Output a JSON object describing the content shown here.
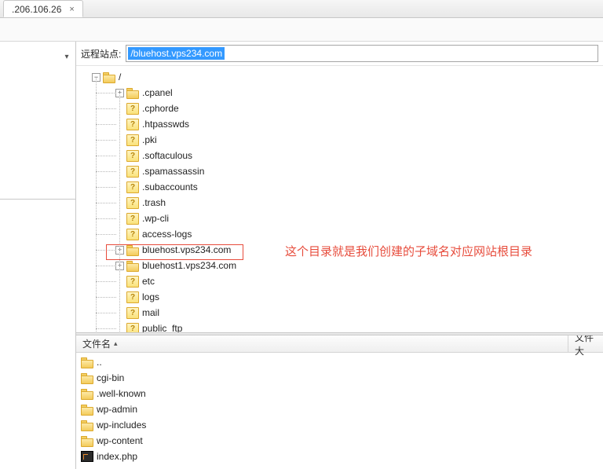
{
  "tab": {
    "label": ".206.106.26",
    "close": "×"
  },
  "remote": {
    "label": "远程站点:",
    "path": "/bluehost.vps234.com"
  },
  "tree": {
    "root": "/",
    "items": [
      {
        "name": ".cpanel",
        "type": "folder",
        "expandable": true
      },
      {
        "name": ".cphorde",
        "type": "unknown",
        "expandable": false
      },
      {
        "name": ".htpasswds",
        "type": "unknown",
        "expandable": false
      },
      {
        "name": ".pki",
        "type": "unknown",
        "expandable": false
      },
      {
        "name": ".softaculous",
        "type": "unknown",
        "expandable": false
      },
      {
        "name": ".spamassassin",
        "type": "unknown",
        "expandable": false
      },
      {
        "name": ".subaccounts",
        "type": "unknown",
        "expandable": false
      },
      {
        "name": ".trash",
        "type": "unknown",
        "expandable": false
      },
      {
        "name": ".wp-cli",
        "type": "unknown",
        "expandable": false
      },
      {
        "name": "access-logs",
        "type": "unknown",
        "expandable": false
      },
      {
        "name": "bluehost.vps234.com",
        "type": "folder",
        "expandable": true,
        "highlighted": true
      },
      {
        "name": "bluehost1.vps234.com",
        "type": "folder",
        "expandable": true
      },
      {
        "name": "etc",
        "type": "unknown",
        "expandable": false
      },
      {
        "name": "logs",
        "type": "unknown",
        "expandable": false
      },
      {
        "name": "mail",
        "type": "unknown",
        "expandable": false
      },
      {
        "name": "public_ftp",
        "type": "unknown",
        "expandable": false
      }
    ]
  },
  "annotation_text": "这个目录就是我们创建的子域名对应网站根目录",
  "file_list": {
    "columns": {
      "name": "文件名",
      "size": "文件大"
    },
    "rows": [
      {
        "name": "..",
        "type": "folder"
      },
      {
        "name": "cgi-bin",
        "type": "folder"
      },
      {
        "name": ".well-known",
        "type": "folder"
      },
      {
        "name": "wp-admin",
        "type": "folder"
      },
      {
        "name": "wp-includes",
        "type": "folder"
      },
      {
        "name": "wp-content",
        "type": "folder"
      },
      {
        "name": "index.php",
        "type": "php"
      }
    ]
  }
}
